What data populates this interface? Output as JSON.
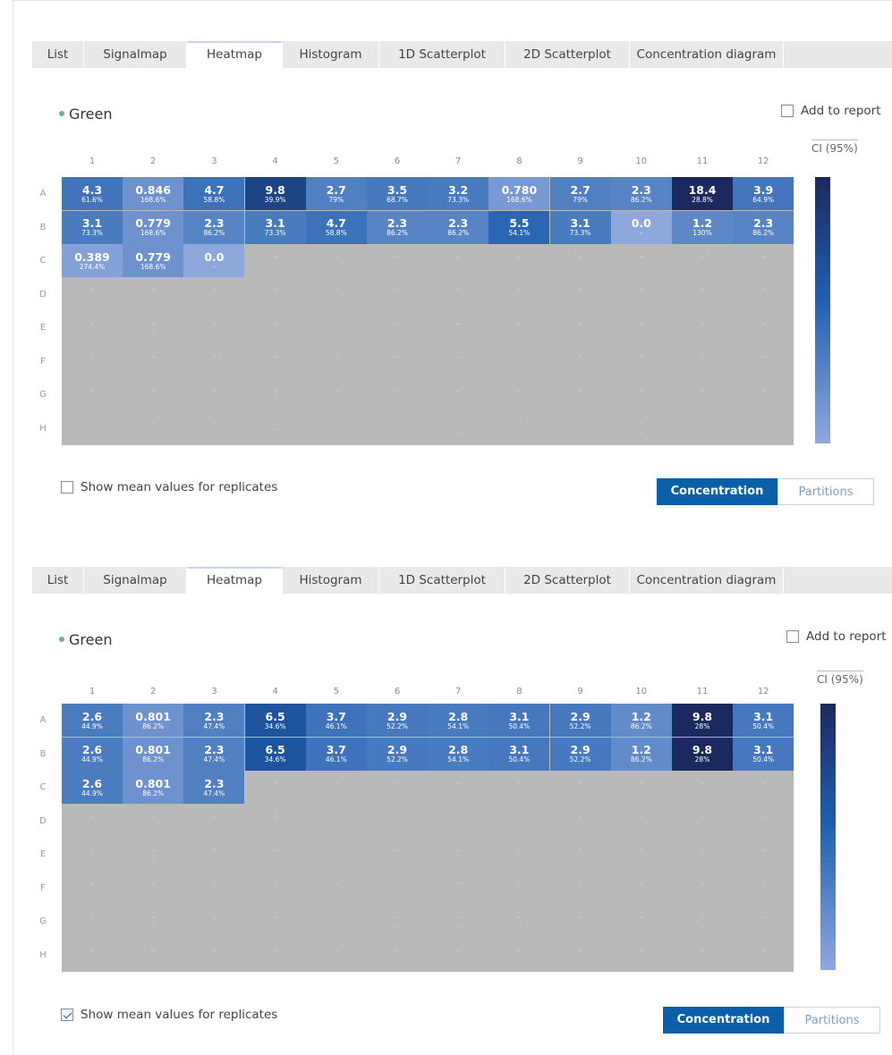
{
  "tabs": [
    "List",
    "Signalmap",
    "Heatmap",
    "Histogram",
    "1D Scatterplot",
    "2D Scatterplot",
    "Concentration diagram"
  ],
  "active_tab": "Heatmap",
  "channel": "Green",
  "add_to_report": "Add to report",
  "ci_label": "CI (95%)",
  "columns": [
    "1",
    "2",
    "3",
    "4",
    "5",
    "6",
    "7",
    "8",
    "9",
    "10",
    "11",
    "12"
  ],
  "rows": [
    "A",
    "B",
    "C",
    "D",
    "E",
    "F",
    "G",
    "H"
  ],
  "show_mean_label": "Show mean values for replicates",
  "toggle": {
    "concentration": "Concentration",
    "partitions": "Partitions"
  },
  "colors": {
    "dark": "#1a2a5e",
    "mid": "#1f5fae",
    "light": "#8ea8dc",
    "empty": "#b9b9b9",
    "accent": "#0b5ea8"
  },
  "empty_value": "-",
  "panels": [
    {
      "show_mean_checked": false,
      "cells": [
        [
          [
            "4.3",
            "61.6%"
          ],
          [
            "0.846",
            "168.6%"
          ],
          [
            "4.7",
            "58.8%"
          ],
          [
            "9.8",
            "39.9%"
          ],
          [
            "2.7",
            "79%"
          ],
          [
            "3.5",
            "68.7%"
          ],
          [
            "3.2",
            "73.3%"
          ],
          [
            "0.780",
            "168.6%"
          ],
          [
            "2.7",
            "79%"
          ],
          [
            "2.3",
            "86.2%"
          ],
          [
            "18.4",
            "28.8%"
          ],
          [
            "3.9",
            "64.9%"
          ]
        ],
        [
          [
            "3.1",
            "73.3%"
          ],
          [
            "0.779",
            "168.6%"
          ],
          [
            "2.3",
            "86.2%"
          ],
          [
            "3.1",
            "73.3%"
          ],
          [
            "4.7",
            "58.8%"
          ],
          [
            "2.3",
            "86.2%"
          ],
          [
            "2.3",
            "86.2%"
          ],
          [
            "5.5",
            "54.1%"
          ],
          [
            "3.1",
            "73.3%"
          ],
          [
            "0.0",
            "-"
          ],
          [
            "1.2",
            "130%"
          ],
          [
            "2.3",
            "86.2%"
          ]
        ],
        [
          [
            "0.389",
            "274.4%"
          ],
          [
            "0.779",
            "168.6%"
          ],
          [
            "0.0",
            "-"
          ]
        ]
      ],
      "shade": [
        [
          0.35,
          0.15,
          0.37,
          0.75,
          0.28,
          0.32,
          0.31,
          0.1,
          0.28,
          0.25,
          1.0,
          0.34
        ],
        [
          0.31,
          0.15,
          0.25,
          0.31,
          0.37,
          0.25,
          0.25,
          0.45,
          0.31,
          0.0,
          0.22,
          0.25
        ],
        [
          0.05,
          0.15,
          0.0
        ]
      ]
    },
    {
      "show_mean_checked": true,
      "cells": [
        [
          [
            "2.6",
            "44.9%"
          ],
          [
            "0.801",
            "86.2%"
          ],
          [
            "2.3",
            "47.4%"
          ],
          [
            "6.5",
            "34.6%"
          ],
          [
            "3.7",
            "46.1%"
          ],
          [
            "2.9",
            "52.2%"
          ],
          [
            "2.8",
            "54.1%"
          ],
          [
            "3.1",
            "50.4%"
          ],
          [
            "2.9",
            "52.2%"
          ],
          [
            "1.2",
            "86.2%"
          ],
          [
            "9.8",
            "28%"
          ],
          [
            "3.1",
            "50.4%"
          ]
        ],
        [
          [
            "2.6",
            "44.9%"
          ],
          [
            "0.801",
            "86.2%"
          ],
          [
            "2.3",
            "47.4%"
          ],
          [
            "6.5",
            "34.6%"
          ],
          [
            "3.7",
            "46.1%"
          ],
          [
            "2.9",
            "52.2%"
          ],
          [
            "2.8",
            "54.1%"
          ],
          [
            "3.1",
            "50.4%"
          ],
          [
            "2.9",
            "52.2%"
          ],
          [
            "1.2",
            "86.2%"
          ],
          [
            "9.8",
            "28%"
          ],
          [
            "3.1",
            "50.4%"
          ]
        ],
        [
          [
            "2.6",
            "44.9%"
          ],
          [
            "0.801",
            "86.2%"
          ],
          [
            "2.3",
            "47.4%"
          ]
        ]
      ],
      "shade": [
        [
          0.3,
          0.15,
          0.28,
          0.6,
          0.36,
          0.32,
          0.31,
          0.33,
          0.32,
          0.2,
          1.0,
          0.33
        ],
        [
          0.3,
          0.15,
          0.28,
          0.6,
          0.36,
          0.32,
          0.31,
          0.33,
          0.32,
          0.2,
          1.0,
          0.33
        ],
        [
          0.3,
          0.15,
          0.28
        ]
      ]
    }
  ]
}
